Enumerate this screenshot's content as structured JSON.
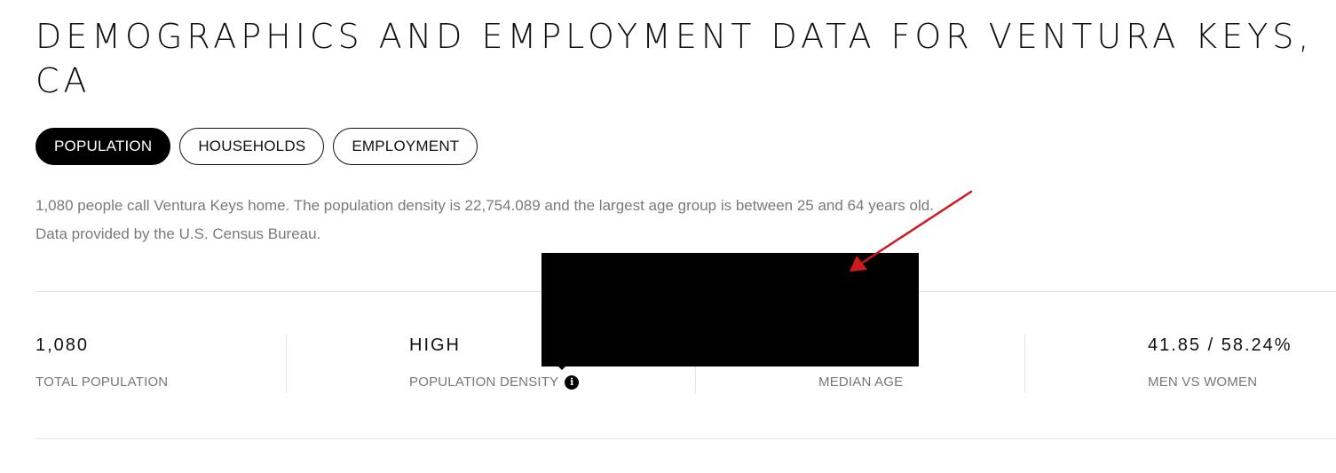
{
  "page": {
    "title": "DEMOGRAPHICS AND EMPLOYMENT DATA FOR VENTURA KEYS,\nCA"
  },
  "tabs": [
    {
      "label": "POPULATION",
      "active": true
    },
    {
      "label": "HOUSEHOLDS",
      "active": false
    },
    {
      "label": "EMPLOYMENT",
      "active": false
    }
  ],
  "description": "1,080 people call Ventura Keys home. The population density is 22,754.089 and the largest age group is between 25 and 64 years old. Data provided by the U.S. Census Bureau.",
  "stats": {
    "total_population": {
      "value": "1,080",
      "label": "TOTAL POPULATION"
    },
    "population_density": {
      "value": "HIGH",
      "label": "POPULATION DENSITY",
      "icon": "info-icon"
    },
    "median_age": {
      "value": "",
      "label": "MEDIAN AGE"
    },
    "men_vs_women": {
      "value": "41.85 / 58.24%",
      "label": "MEN VS WOMEN"
    }
  },
  "colors": {
    "annotation_arrow": "#d0191c",
    "active_tab_bg": "#000000",
    "redaction": "#000000",
    "muted_text": "#7a7a7a"
  }
}
